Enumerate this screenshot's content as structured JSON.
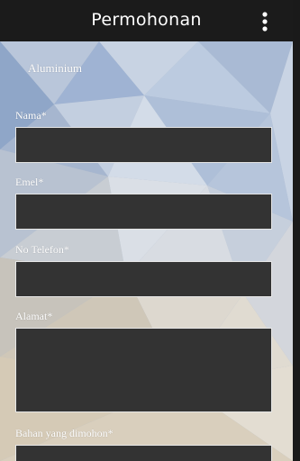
{
  "appbar": {
    "title": "Permohonan",
    "menu_icon": "overflow-menu-icon"
  },
  "form": {
    "selected_item": "Aluminium",
    "fields": [
      {
        "label": "Nama*",
        "value": ""
      },
      {
        "label": "Emel*",
        "value": ""
      },
      {
        "label": "No Telefon*",
        "value": ""
      },
      {
        "label": "Alamat*",
        "value": ""
      },
      {
        "label": "Bahan yang dimohon*",
        "value": ""
      }
    ]
  },
  "colors": {
    "appbar": "#1b1b1b",
    "input_bg": "#333333",
    "input_border": "#e6e6e6"
  }
}
